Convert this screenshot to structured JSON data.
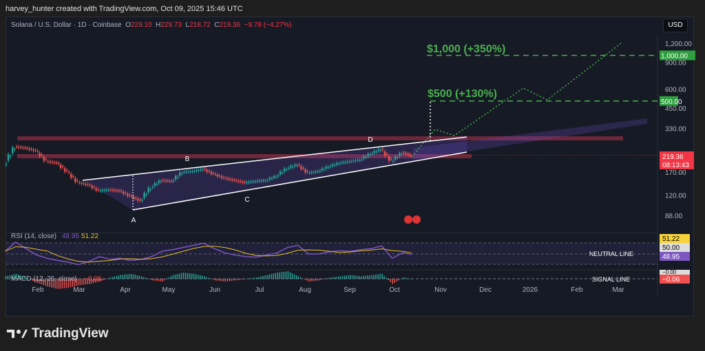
{
  "header": {
    "credit": "harvey_hunter created with TradingView.com, Oct 09, 2025 15:46 UTC",
    "symbol": "Solana / U.S. Dollar · 1D · Coinbase",
    "o_label": "O",
    "o": "229.10",
    "h_label": "H",
    "h": "229.73",
    "l_label": "L",
    "l": "218.72",
    "c_label": "C",
    "c": "219.36",
    "change": "−9.78 (−4.27%)",
    "currency": "USD"
  },
  "footer": {
    "brand": "TradingView"
  },
  "colors": {
    "up": "#26a69a",
    "down": "#ef5350",
    "target": "#4caf50",
    "zone": "#b2324a",
    "wedge": "#6a4fc7",
    "rsi": "#7e57c2",
    "rsi_ma": "#e6c229"
  },
  "chart_data": [
    {
      "type": "candlestick",
      "scale": "log",
      "grid": false,
      "x_ticks": [
        "Feb",
        "Mar",
        "Apr",
        "May",
        "Jun",
        "Jul",
        "Aug",
        "Sep",
        "Oct",
        "Nov",
        "Dec",
        "2026",
        "Feb",
        "Mar"
      ],
      "y_ticks": [
        "1,200.00",
        "900.00",
        "600.00",
        "450.00",
        "330.00",
        "170.00",
        "120.00",
        "88.00"
      ],
      "weekly_close": [
        {
          "d": "2025-01-10",
          "c": 190
        },
        {
          "d": "2025-01-17",
          "c": 250
        },
        {
          "d": "2025-01-24",
          "c": 245
        },
        {
          "d": "2025-01-31",
          "c": 235
        },
        {
          "d": "2025-02-07",
          "c": 200
        },
        {
          "d": "2025-02-14",
          "c": 195
        },
        {
          "d": "2025-02-21",
          "c": 170
        },
        {
          "d": "2025-02-28",
          "c": 145
        },
        {
          "d": "2025-03-07",
          "c": 140
        },
        {
          "d": "2025-03-14",
          "c": 128
        },
        {
          "d": "2025-03-21",
          "c": 130
        },
        {
          "d": "2025-03-28",
          "c": 128
        },
        {
          "d": "2025-04-04",
          "c": 118
        },
        {
          "d": "2025-04-11",
          "c": 110
        },
        {
          "d": "2025-04-18",
          "c": 135
        },
        {
          "d": "2025-04-25",
          "c": 150
        },
        {
          "d": "2025-05-02",
          "c": 148
        },
        {
          "d": "2025-05-09",
          "c": 170
        },
        {
          "d": "2025-05-16",
          "c": 172
        },
        {
          "d": "2025-05-23",
          "c": 178
        },
        {
          "d": "2025-05-30",
          "c": 165
        },
        {
          "d": "2025-06-06",
          "c": 155
        },
        {
          "d": "2025-06-13",
          "c": 150
        },
        {
          "d": "2025-06-20",
          "c": 145
        },
        {
          "d": "2025-06-27",
          "c": 148
        },
        {
          "d": "2025-07-04",
          "c": 150
        },
        {
          "d": "2025-07-11",
          "c": 160
        },
        {
          "d": "2025-07-18",
          "c": 180
        },
        {
          "d": "2025-07-25",
          "c": 190
        },
        {
          "d": "2025-08-01",
          "c": 168
        },
        {
          "d": "2025-08-08",
          "c": 172
        },
        {
          "d": "2025-08-15",
          "c": 185
        },
        {
          "d": "2025-08-22",
          "c": 195
        },
        {
          "d": "2025-08-29",
          "c": 200
        },
        {
          "d": "2025-09-05",
          "c": 205
        },
        {
          "d": "2025-09-12",
          "c": 225
        },
        {
          "d": "2025-09-19",
          "c": 240
        },
        {
          "d": "2025-09-26",
          "c": 200
        },
        {
          "d": "2025-10-03",
          "c": 228
        },
        {
          "d": "2025-10-09",
          "c": 219.36
        }
      ],
      "price_labels": [
        {
          "value": "1,000.00",
          "color": "#2e9e3f"
        },
        {
          "value": "500.00",
          "color": "#2e9e3f"
        },
        {
          "value": "219.36",
          "sub": "08:13:43",
          "color": "#f23645"
        }
      ],
      "annotations": {
        "points": [
          "A",
          "B",
          "C",
          "D"
        ],
        "targets": [
          {
            "label": "$500 (+130%)",
            "price": 500
          },
          {
            "label": "$1,000 (+350%)",
            "price": 1000
          }
        ]
      }
    },
    {
      "type": "line",
      "name": "RSI (14, close)",
      "value": "48.95",
      "ma_value": "51.22",
      "levels": [
        "50.00"
      ],
      "label": "NEUTRAL LINE",
      "values": [
        55,
        72,
        60,
        48,
        42,
        38,
        35,
        30,
        36,
        45,
        40,
        42,
        38,
        40,
        45,
        55,
        58,
        62,
        66,
        70,
        60,
        52,
        48,
        45,
        44,
        48,
        52,
        62,
        66,
        50,
        50,
        54,
        56,
        55,
        58,
        60,
        65,
        42,
        52,
        48.95
      ]
    },
    {
      "type": "histogram",
      "name": "MACD (12, 26, close)",
      "value": "−0.06",
      "label": "SIGNAL LINE",
      "axis_label": "−0.00",
      "values": [
        2,
        4,
        1,
        -3,
        -6,
        -8,
        -7,
        -5,
        -4,
        -2,
        1,
        3,
        4,
        2,
        -1,
        -2,
        3,
        5,
        4,
        2,
        -1,
        -2,
        -1,
        0,
        1,
        3,
        5,
        6,
        2,
        -2,
        -1,
        1,
        2,
        3,
        2,
        3,
        4,
        -4,
        1,
        -0.06
      ]
    }
  ]
}
